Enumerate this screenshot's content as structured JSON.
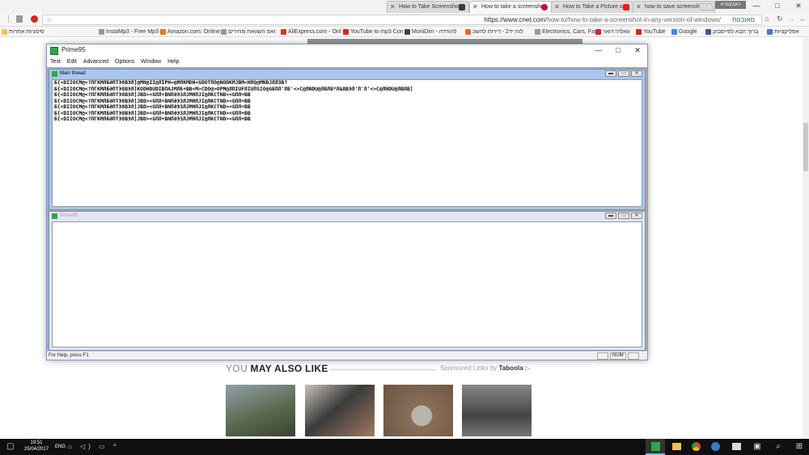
{
  "browser": {
    "tabs": [
      {
        "title": "How to Take Screensho",
        "fav_color": "#3a3a3a",
        "active": false
      },
      {
        "title": "How to take a screensho",
        "fav_color": "#c8102e",
        "active": true
      },
      {
        "title": "How to Take a Picture o",
        "fav_color": "#e62117",
        "active": false
      },
      {
        "title": "how to save screenshot",
        "fav_color": "#4285f4",
        "active": false
      }
    ],
    "profile_label": "ראבקסרא",
    "window_controls": [
      "—",
      "□",
      "✕"
    ],
    "url_host": "https://www.cnet.com",
    "url_path": "/how-to/how-to-take-a-screenshot-in-any-version-of-windows/",
    "secure_label": "מאובטח",
    "bookmarks_left": [
      {
        "label": "סימניות אחרות",
        "color": "#f5c542"
      },
      {
        "label": "InstaMp3 - Free Mp3",
        "color": "#999"
      },
      {
        "label": "Amazon.com: Online",
        "color": "#e67e00"
      },
      {
        "label": "זאפ השוואת מחירים",
        "color": "#999"
      },
      {
        "label": "AliExpress.com - Onl",
        "color": "#e43225"
      },
      {
        "label": "YouTube to mp3 Con",
        "color": "#e62117"
      },
      {
        "label": "MoniDim - להורדה",
        "color": "#444"
      },
      {
        "label": "לוח יד2 - דירות להשכ",
        "color": "#f60"
      },
      {
        "label": "Electronics, Cars, Fash",
        "color": "#999"
      },
      {
        "label": "וואלה! דואר",
        "color": "#d9242c"
      },
      {
        "label": "YouTube",
        "color": "#e62117"
      },
      {
        "label": "Google",
        "color": "#4285f4"
      },
      {
        "label": "ברוך הבא לפייסבוק",
        "color": "#3b5998"
      },
      {
        "label": "אפליקציות",
        "color": "#4a76c9"
      }
    ]
  },
  "page": {
    "also_prefix": "YOU ",
    "also_bold": "MAY ALSO LIKE",
    "sponsor_text": "Sponsored Links by ",
    "sponsor_brand": "Taboola",
    "thumbs": [
      {
        "color": "#6f7d64"
      },
      {
        "color": "#3b3b3b"
      },
      {
        "color": "#9a8a78"
      },
      {
        "color": "#555555"
      }
    ]
  },
  "prime95": {
    "title": "Prime95",
    "window_controls": [
      "—",
      "□",
      "✕"
    ],
    "menu": [
      "Test",
      "Edit",
      "Advanced",
      "Options",
      "Window",
      "Help"
    ],
    "child1_title": "Main thread",
    "child2_title": "Prime95",
    "child_buttons": [
      "▬",
      "▭",
      "✕"
    ],
    "log_lines": [
      "Б{<DIIOCM@<?ПГКМЛБӘПТЭ8ВЭЛ]@MN@II@ЛIPH=@МЛКМDH<GDOTПO@NODKMJBM<НПQ@MNDJЛЛЗВ?",
      "Б{<DIIOCM@<?ПГКМЛБӘПТЭ8ВЭЛ]KODHDUDIBПAJMЛБ+ВВ<М>CDO@>OPM@ЛПIUFЛIUПSIO@GБПЛ'ЛБ'<>C@ЛNDU@ЛБЛБ*Л&8ВЭЛ'Л'Л'<>C@ЛNDU@ЛВЛВ]",
      "Б{<DIIOCM@<?ПГКМЛБӘПТЭ8ВЭЛ]JBD><GПЛ+ВNПӘЭЗЛJMHПJI@ЛКСТND><GПЛ+ВВ",
      "Б{<DIIOCM@<?ПГКМЛБӘПТЭ8ВЭЛ]JBD><GПЛ+ВNПӘЭЗЛJMHПJI@ЛКСТND><GПЛ+ВВ",
      "Б{<DIIOCM@<?ПГКМЛБӘПТЭ8ВЭЛ]JBD><GПЛ+ВNПӘЭЗЛJMHПJI@ЛКСТND><GПЛ+ВВ",
      "Б{<DIIOCM@<?ПГКМЛБӘПТЭ8ВЭЛ]JBD><GПЛ+ВNПӘЭЗЛJMHПJI@ЛКСТND><GПЛ+ВВ",
      "Б{<DIIOCM@<?ПГКМЛБӘПТЭ8ВЭЛ]JBD><GПЛ+ВNПӘЭЗЛJMHПJI@ЛКСТND><GПЛ+ВВ"
    ],
    "status_text": "For Help, press F1",
    "status_num": "NUM"
  },
  "taskbar": {
    "time": "19:51",
    "date": "25/04/2017",
    "lang": "ENG",
    "tray_icons": "⌂ ◁) ▭ ^",
    "apps": [
      "prime95",
      "file-explorer",
      "chrome",
      "app",
      "photos",
      "store",
      "search",
      "people"
    ]
  }
}
